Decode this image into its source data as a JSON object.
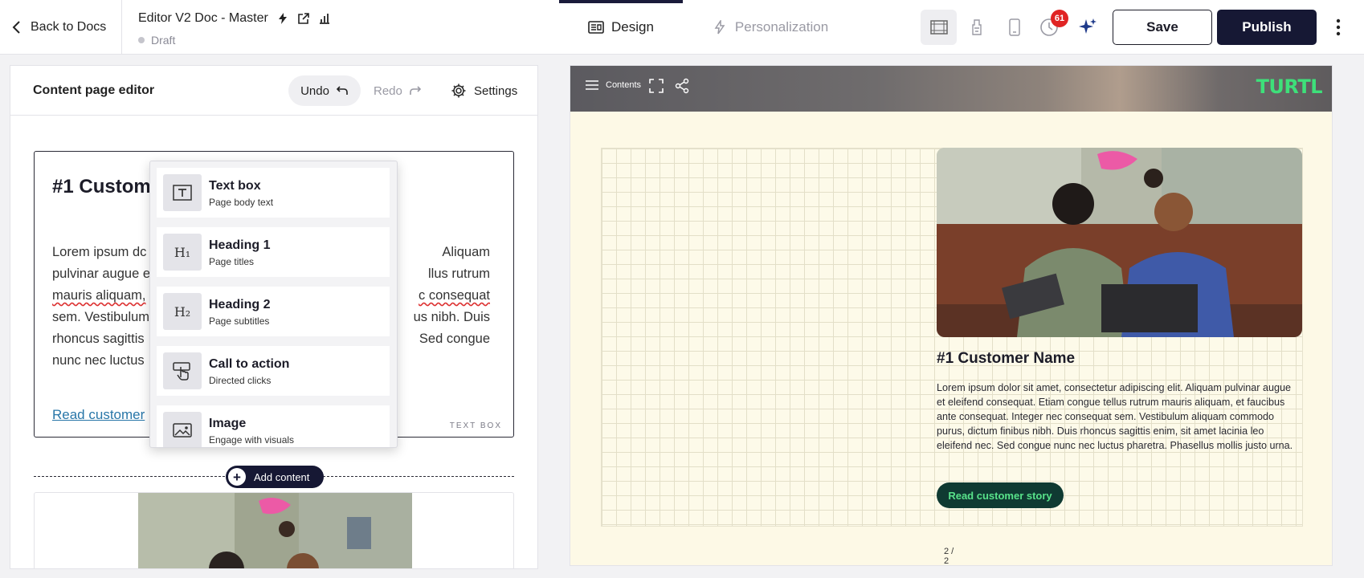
{
  "topbar": {
    "back_label": "Back to Docs",
    "doc_title": "Editor V2 Doc - Master",
    "doc_status": "Draft",
    "tabs": [
      {
        "label": "Design",
        "active": true
      },
      {
        "label": "Personalization",
        "active": false
      }
    ],
    "notification_count": "61",
    "save_label": "Save",
    "publish_label": "Publish",
    "icons": {
      "back": "chevron-left-icon",
      "bolt": "bolt-icon",
      "external": "external-link-icon",
      "analytics": "bar-chart-icon",
      "design": "layout-icon",
      "personalization": "bolt-icon",
      "desktop": "desktop-view-icon",
      "tablet": "tablet-view-icon",
      "mobile": "mobile-view-icon",
      "history": "history-icon",
      "ai": "sparkle-icon",
      "more": "kebab-icon"
    }
  },
  "editor": {
    "title": "Content page editor",
    "undo_label": "Undo",
    "redo_label": "Redo",
    "settings_label": "Settings",
    "text_card": {
      "heading": "#1 Custome",
      "body_lines": [
        "Lorem ipsum dc",
        "pulvinar augue e",
        "mauris aliquam,",
        "sem. Vestibulum",
        "rhoncus sagittis",
        "nunc nec luctus"
      ],
      "body_right_lines": [
        "Aliquam",
        "llus rutrum",
        "c consequat",
        "us nibh. Duis",
        "Sed congue",
        ""
      ],
      "link": "Read customer",
      "type_label": "TEXT BOX"
    },
    "add_content_label": "Add content",
    "menu_items": [
      {
        "title": "Text box",
        "subtitle": "Page body text",
        "icon": "text-box-icon"
      },
      {
        "title": "Heading 1",
        "subtitle": "Page titles",
        "icon": "heading-1-icon",
        "glyph": "H₁"
      },
      {
        "title": "Heading 2",
        "subtitle": "Page subtitles",
        "icon": "heading-2-icon",
        "glyph": "H₂"
      },
      {
        "title": "Call to action",
        "subtitle": "Directed clicks",
        "icon": "cta-pointer-icon"
      },
      {
        "title": "Image",
        "subtitle": "Engage with visuals",
        "icon": "image-icon"
      }
    ]
  },
  "preview": {
    "contents_label": "Contents",
    "logo": "TURTL",
    "customer_name": "#1 Customer Name",
    "body": "Lorem ipsum dolor sit amet, consectetur adipiscing elit. Aliquam pulvinar augue et eleifend consequat. Etiam congue tellus rutrum mauris aliquam, et faucibus ante consequat. Integer nec consequat sem. Vestibulum aliquam commodo purus, dictum finibus nibh. Duis rhoncus sagittis enim, sit amet lacinia leo eleifend nec. Sed congue nunc nec luctus pharetra. Phasellus mollis justo urna.",
    "cta_label": "Read customer story",
    "page_indicator": "2 / 2",
    "colors": {
      "logo": "#3ee07a",
      "cta_bg": "#0f3a32",
      "cta_text": "#58e28a",
      "canvas": "#fdf9e6"
    }
  },
  "colors": {
    "primary": "#161834",
    "badge": "#e02424",
    "link": "#2876a8"
  }
}
